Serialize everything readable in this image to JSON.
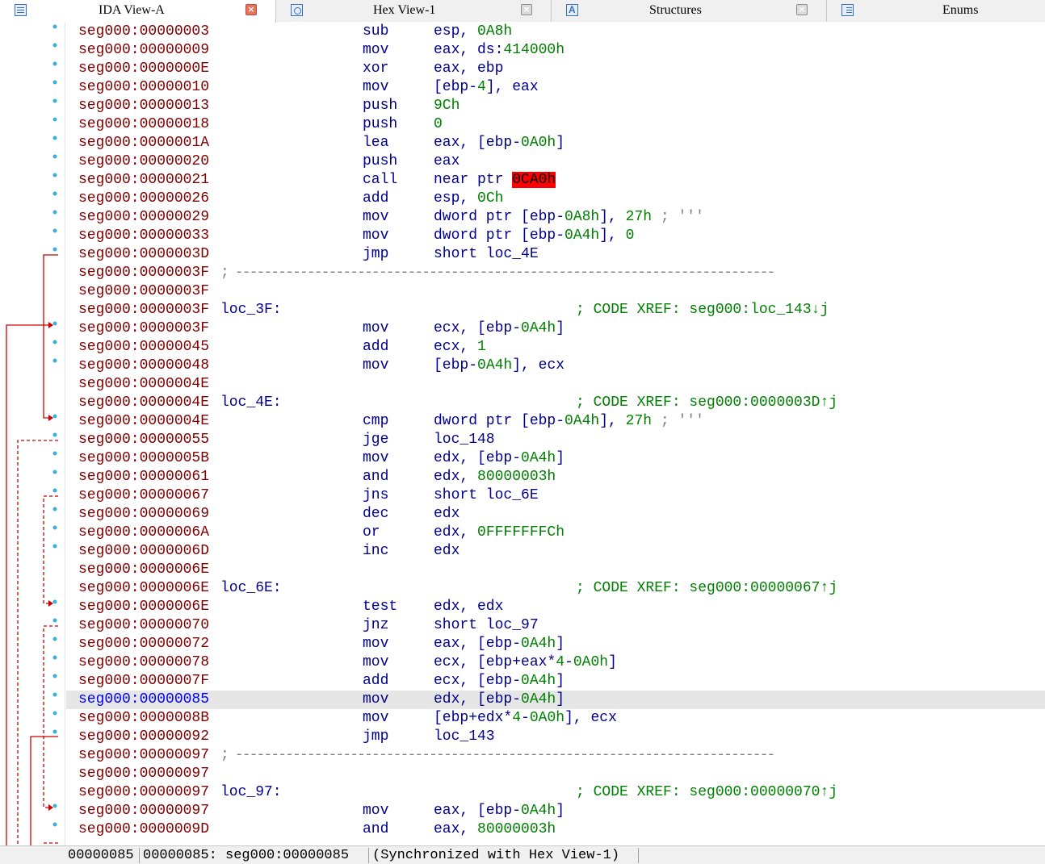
{
  "tabs": [
    {
      "label": "IDA View-A",
      "active": true,
      "icon": "listing-icon"
    },
    {
      "label": "Hex View-1",
      "active": false,
      "icon": "hex-icon"
    },
    {
      "label": "Structures",
      "active": false,
      "icon": "structures-icon"
    },
    {
      "label": "Enums",
      "active": false,
      "icon": "enums-icon"
    }
  ],
  "tab_close_glyph": "×",
  "listing": [
    {
      "addr": "seg000:00000003",
      "mnem": "sub",
      "ops": [
        {
          "t": "esp, "
        },
        {
          "t": "0A8h",
          "c": "num"
        }
      ]
    },
    {
      "addr": "seg000:00000009",
      "mnem": "mov",
      "ops": [
        {
          "t": "eax, ds:"
        },
        {
          "t": "414000h",
          "c": "num"
        }
      ]
    },
    {
      "addr": "seg000:0000000E",
      "mnem": "xor",
      "ops": [
        {
          "t": "eax, ebp"
        }
      ]
    },
    {
      "addr": "seg000:00000010",
      "mnem": "mov",
      "ops": [
        {
          "t": "[ebp-"
        },
        {
          "t": "4",
          "c": "num"
        },
        {
          "t": "], eax"
        }
      ]
    },
    {
      "addr": "seg000:00000013",
      "mnem": "push",
      "ops": [
        {
          "t": "9Ch",
          "c": "num"
        }
      ]
    },
    {
      "addr": "seg000:00000018",
      "mnem": "push",
      "ops": [
        {
          "t": "0",
          "c": "num"
        }
      ]
    },
    {
      "addr": "seg000:0000001A",
      "mnem": "lea",
      "ops": [
        {
          "t": "eax, [ebp-"
        },
        {
          "t": "0A0h",
          "c": "num"
        },
        {
          "t": "]"
        }
      ]
    },
    {
      "addr": "seg000:00000020",
      "mnem": "push",
      "ops": [
        {
          "t": "eax"
        }
      ]
    },
    {
      "addr": "seg000:00000021",
      "mnem": "call",
      "ops": [
        {
          "t": "near ptr "
        },
        {
          "t": "0CA0h",
          "c": "err"
        }
      ]
    },
    {
      "addr": "seg000:00000026",
      "mnem": "add",
      "ops": [
        {
          "t": "esp, "
        },
        {
          "t": "0Ch",
          "c": "num"
        }
      ]
    },
    {
      "addr": "seg000:00000029",
      "mnem": "mov",
      "ops": [
        {
          "t": "dword ptr [ebp-"
        },
        {
          "t": "0A8h",
          "c": "num"
        },
        {
          "t": "], "
        },
        {
          "t": "27h",
          "c": "num"
        },
        {
          "t": " ; '''",
          "c": "cmt-inline"
        }
      ]
    },
    {
      "addr": "seg000:00000033",
      "mnem": "mov",
      "ops": [
        {
          "t": "dword ptr [ebp-"
        },
        {
          "t": "0A4h",
          "c": "num"
        },
        {
          "t": "], "
        },
        {
          "t": "0",
          "c": "num"
        }
      ]
    },
    {
      "addr": "seg000:0000003D",
      "mnem": "jmp",
      "ops": [
        {
          "t": "short loc_4E"
        }
      ]
    },
    {
      "addr": "seg000:0000003F",
      "sep": "; ---------------------------------------------------------------------------"
    },
    {
      "addr": "seg000:0000003F"
    },
    {
      "addr": "seg000:0000003F",
      "label": "loc_3F:",
      "xref": "; CODE XREF: seg000:loc_143↓j"
    },
    {
      "addr": "seg000:0000003F",
      "mnem": "mov",
      "ops": [
        {
          "t": "ecx, [ebp-"
        },
        {
          "t": "0A4h",
          "c": "num"
        },
        {
          "t": "]"
        }
      ]
    },
    {
      "addr": "seg000:00000045",
      "mnem": "add",
      "ops": [
        {
          "t": "ecx, "
        },
        {
          "t": "1",
          "c": "num"
        }
      ]
    },
    {
      "addr": "seg000:00000048",
      "mnem": "mov",
      "ops": [
        {
          "t": "[ebp-"
        },
        {
          "t": "0A4h",
          "c": "num"
        },
        {
          "t": "], ecx"
        }
      ]
    },
    {
      "addr": "seg000:0000004E"
    },
    {
      "addr": "seg000:0000004E",
      "label": "loc_4E:",
      "xref": "; CODE XREF: seg000:0000003D↑j"
    },
    {
      "addr": "seg000:0000004E",
      "mnem": "cmp",
      "ops": [
        {
          "t": "dword ptr [ebp-"
        },
        {
          "t": "0A4h",
          "c": "num"
        },
        {
          "t": "], "
        },
        {
          "t": "27h",
          "c": "num"
        },
        {
          "t": " ; '''",
          "c": "cmt-inline"
        }
      ]
    },
    {
      "addr": "seg000:00000055",
      "mnem": "jge",
      "ops": [
        {
          "t": "loc_148"
        }
      ]
    },
    {
      "addr": "seg000:0000005B",
      "mnem": "mov",
      "ops": [
        {
          "t": "edx, [ebp-"
        },
        {
          "t": "0A4h",
          "c": "num"
        },
        {
          "t": "]"
        }
      ]
    },
    {
      "addr": "seg000:00000061",
      "mnem": "and",
      "ops": [
        {
          "t": "edx, "
        },
        {
          "t": "80000003h",
          "c": "num"
        }
      ]
    },
    {
      "addr": "seg000:00000067",
      "mnem": "jns",
      "ops": [
        {
          "t": "short loc_6E"
        }
      ]
    },
    {
      "addr": "seg000:00000069",
      "mnem": "dec",
      "ops": [
        {
          "t": "edx"
        }
      ]
    },
    {
      "addr": "seg000:0000006A",
      "mnem": "or",
      "ops": [
        {
          "t": "edx, "
        },
        {
          "t": "0FFFFFFFCh",
          "c": "num"
        }
      ]
    },
    {
      "addr": "seg000:0000006D",
      "mnem": "inc",
      "ops": [
        {
          "t": "edx"
        }
      ]
    },
    {
      "addr": "seg000:0000006E"
    },
    {
      "addr": "seg000:0000006E",
      "label": "loc_6E:",
      "xref": "; CODE XREF: seg000:00000067↑j"
    },
    {
      "addr": "seg000:0000006E",
      "mnem": "test",
      "ops": [
        {
          "t": "edx, edx"
        }
      ]
    },
    {
      "addr": "seg000:00000070",
      "mnem": "jnz",
      "ops": [
        {
          "t": "short loc_97"
        }
      ]
    },
    {
      "addr": "seg000:00000072",
      "mnem": "mov",
      "ops": [
        {
          "t": "eax, [ebp-"
        },
        {
          "t": "0A4h",
          "c": "num"
        },
        {
          "t": "]"
        }
      ]
    },
    {
      "addr": "seg000:00000078",
      "mnem": "mov",
      "ops": [
        {
          "t": "ecx, [ebp+eax*"
        },
        {
          "t": "4",
          "c": "num"
        },
        {
          "t": "-"
        },
        {
          "t": "0A0h",
          "c": "num"
        },
        {
          "t": "]"
        }
      ]
    },
    {
      "addr": "seg000:0000007F",
      "mnem": "add",
      "ops": [
        {
          "t": "ecx, [ebp-"
        },
        {
          "t": "0A4h",
          "c": "num"
        },
        {
          "t": "]"
        }
      ]
    },
    {
      "addr": "seg000:00000085",
      "mnem": "mov",
      "current": true,
      "ops": [
        {
          "t": "edx, [ebp-"
        },
        {
          "t": "0A4h",
          "c": "num"
        },
        {
          "t": "]"
        }
      ]
    },
    {
      "addr": "seg000:0000008B",
      "mnem": "mov",
      "ops": [
        {
          "t": "[ebp+edx*"
        },
        {
          "t": "4",
          "c": "num"
        },
        {
          "t": "-"
        },
        {
          "t": "0A0h",
          "c": "num"
        },
        {
          "t": "], ecx"
        }
      ]
    },
    {
      "addr": "seg000:00000092",
      "mnem": "jmp",
      "ops": [
        {
          "t": "loc_143"
        }
      ]
    },
    {
      "addr": "seg000:00000097",
      "sep": "; ---------------------------------------------------------------------------"
    },
    {
      "addr": "seg000:00000097"
    },
    {
      "addr": "seg000:00000097",
      "label": "loc_97:",
      "xref": "; CODE XREF: seg000:00000070↑j"
    },
    {
      "addr": "seg000:00000097",
      "mnem": "mov",
      "ops": [
        {
          "t": "eax, [ebp-"
        },
        {
          "t": "0A4h",
          "c": "num"
        },
        {
          "t": "]"
        }
      ]
    },
    {
      "addr": "seg000:0000009D",
      "mnem": "and",
      "ops": [
        {
          "t": "eax, "
        },
        {
          "t": "80000003h",
          "c": "num"
        }
      ]
    }
  ],
  "status": {
    "offset": "00000085",
    "location": "00000085: seg000:00000085",
    "sync": "(Synchronized with Hex View-1)"
  },
  "colors": {
    "address": "#800000",
    "current_address": "#0000ff",
    "instruction": "#00008b",
    "number": "#008000",
    "xref_comment": "#008000",
    "error_highlight": "#ff0000",
    "arrow": "#cc0000",
    "breakpoint_dot": "#3ab0e0"
  }
}
